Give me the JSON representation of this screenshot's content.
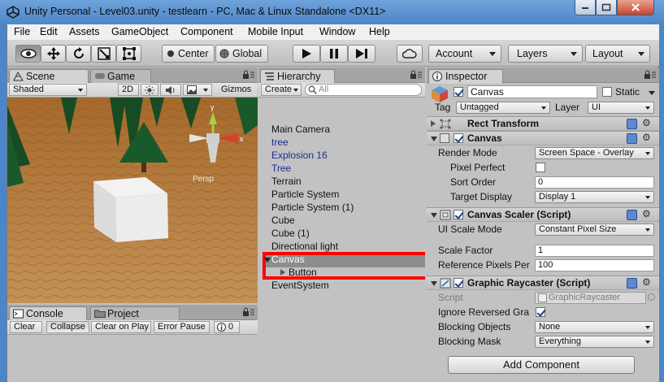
{
  "window": {
    "title": "Unity Personal - Level03.unity - testlearn - PC, Mac & Linux Standalone <DX11>"
  },
  "menu": [
    "File",
    "Edit",
    "Assets",
    "GameObject",
    "Component",
    "Mobile Input",
    "Window",
    "Help"
  ],
  "toolbar": {
    "pivot_label": "Center",
    "space_label": "Global",
    "account_label": "Account",
    "layers_label": "Layers",
    "layout_label": "Layout"
  },
  "scene": {
    "tab_scene": "Scene",
    "tab_game": "Game",
    "shading_mode": "Shaded",
    "mode_2d": "2D",
    "gizmos_label": "Gizmos",
    "gizmo_axis_y": "y",
    "gizmo_axis_x": "x",
    "projection_label": "Persp"
  },
  "console": {
    "tab_console": "Console",
    "tab_project": "Project",
    "buttons": [
      "Clear",
      "Collapse",
      "Clear on Play",
      "Error Pause"
    ],
    "counter": "0"
  },
  "hierarchy": {
    "tab_label": "Hierarchy",
    "create_label": "Create",
    "search_placeholder": "All",
    "items": [
      {
        "label": "Main Camera",
        "kind": "normal"
      },
      {
        "label": "tree",
        "kind": "prefab"
      },
      {
        "label": "Explosion 16",
        "kind": "prefab"
      },
      {
        "label": "Tree",
        "kind": "prefab"
      },
      {
        "label": "Terrain",
        "kind": "normal"
      },
      {
        "label": "Particle System",
        "kind": "normal"
      },
      {
        "label": "Particle System (1)",
        "kind": "normal"
      },
      {
        "label": "Cube",
        "kind": "normal"
      },
      {
        "label": "Cube (1)",
        "kind": "normal"
      },
      {
        "label": "Directional light",
        "kind": "normal"
      },
      {
        "label": "Canvas",
        "kind": "selected"
      },
      {
        "label": "Button",
        "kind": "child"
      },
      {
        "label": "EventSystem",
        "kind": "normal"
      }
    ],
    "highlight_color": "#ff0000"
  },
  "inspector": {
    "tab_label": "Inspector",
    "object_name": "Canvas",
    "static_label": "Static",
    "tag_label": "Tag",
    "tag_value": "Untagged",
    "layer_label": "Layer",
    "layer_value": "UI",
    "rect_transform": {
      "title": "Rect Transform"
    },
    "canvas": {
      "title": "Canvas",
      "render_mode_label": "Render Mode",
      "render_mode_value": "Screen Space - Overlay",
      "pixel_perfect_label": "Pixel Perfect",
      "sort_order_label": "Sort Order",
      "sort_order_value": "0",
      "target_display_label": "Target Display",
      "target_display_value": "Display 1"
    },
    "canvas_scaler": {
      "title": "Canvas Scaler (Script)",
      "ui_scale_mode_label": "UI Scale Mode",
      "ui_scale_mode_value": "Constant Pixel Size",
      "scale_factor_label": "Scale Factor",
      "scale_factor_value": "1",
      "ref_pixels_label": "Reference Pixels Per",
      "ref_pixels_value": "100"
    },
    "graphic_raycaster": {
      "title": "Graphic Raycaster (Script)",
      "script_label": "Script",
      "script_value": "GraphicRaycaster",
      "ignore_reversed_label": "Ignore Reversed Gra",
      "blocking_objects_label": "Blocking Objects",
      "blocking_objects_value": "None",
      "blocking_mask_label": "Blocking Mask",
      "blocking_mask_value": "Everything"
    },
    "add_component_label": "Add Component"
  },
  "colors": {
    "unity_panel": "#c2c2c2",
    "selection": "#8d8d8d",
    "prefab_text": "#1a2c8c"
  }
}
